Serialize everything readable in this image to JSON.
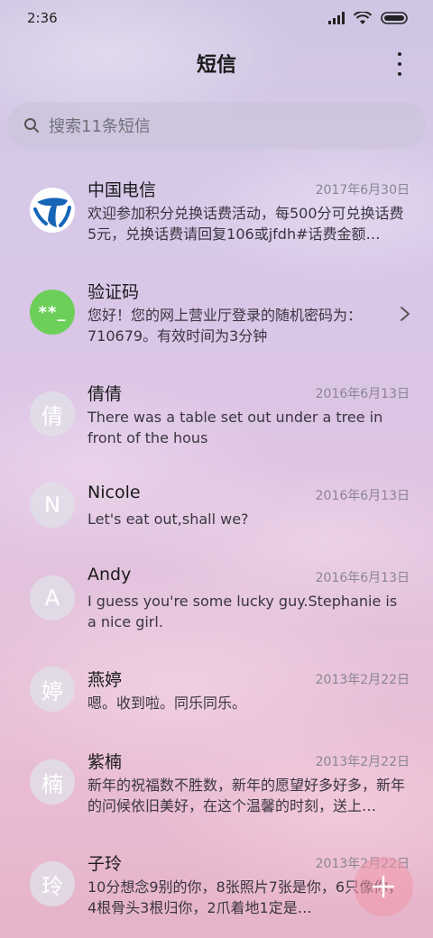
{
  "status_bar": {
    "time": "2:36"
  },
  "header": {
    "title": "短信"
  },
  "search": {
    "placeholder": "搜索11条短信"
  },
  "conversations": [
    {
      "name": "中国电信",
      "date": "2017年6月30日",
      "preview": "欢迎参加积分兑换话费活动，每500分可兑换话费5元，兑换话费请回复106或jfdh#话费金额…",
      "avatar": "china-telecom-logo"
    },
    {
      "name": "验证码",
      "date": "",
      "preview": "您好！您的网上营业厅登录的随机密码为：710679。有效时间为3分钟",
      "avatar_text": "**_",
      "avatar_color": "#6ccf5a"
    },
    {
      "name": "倩倩",
      "date": "2016年6月13日",
      "preview": "There was a table set out under a tree in front of the hous",
      "avatar_text": "倩"
    },
    {
      "name": "Nicole",
      "date": "2016年6月13日",
      "preview": "Let's eat out,shall we?",
      "avatar_text": "N"
    },
    {
      "name": "Andy",
      "date": "2016年6月13日",
      "preview": "I guess you're some lucky guy.Stephanie is a nice girl.",
      "avatar_text": "A"
    },
    {
      "name": "燕婷",
      "date": "2013年2月22日",
      "preview": "嗯。收到啦。同乐同乐。",
      "avatar_text": "婷"
    },
    {
      "name": "紫楠",
      "date": "2013年2月22日",
      "preview": "新年的祝福数不胜数，新年的愿望好多好多，新年的问候依旧美好，在这个温馨的时刻，送上…",
      "avatar_text": "楠"
    },
    {
      "name": "子玲",
      "date": "2013年2月22日",
      "preview": "10分想念9别的你，8张照片7张是你，6只像你，4根骨头3根归你，2爪着地1定是…",
      "avatar_text": "玲"
    }
  ],
  "colors": {
    "verify_avatar": "#6ccf5a",
    "telecom_blue": "#1665b8",
    "fab": "#f096aa"
  }
}
